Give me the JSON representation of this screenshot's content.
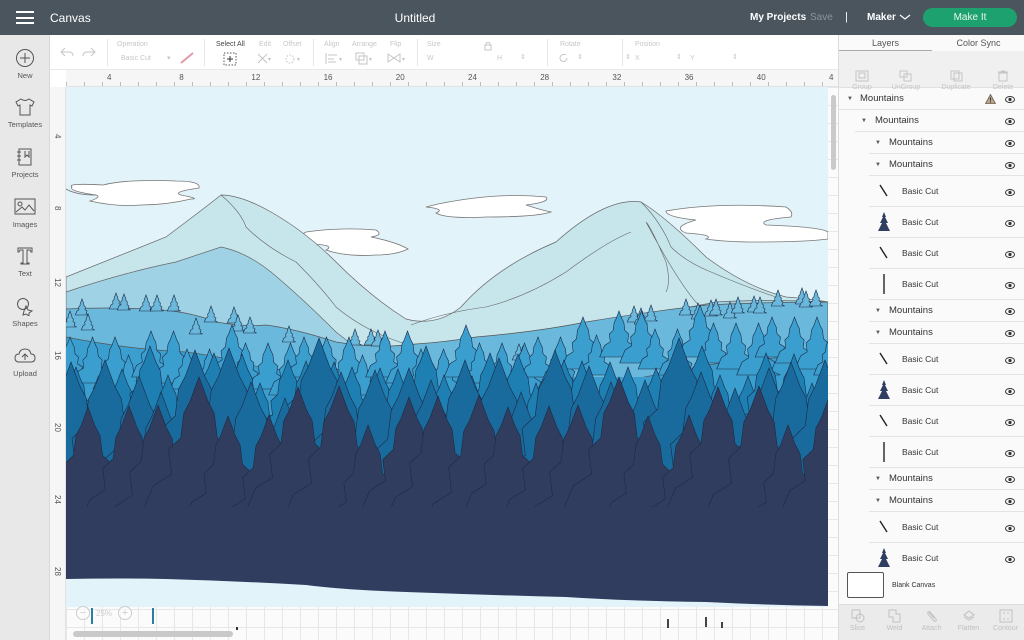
{
  "topbar": {
    "menu_icon": "hamburger-icon",
    "app_name": "Canvas",
    "doc_title": "Untitled",
    "my_projects": "My Projects",
    "save": "Save",
    "separator": "|",
    "machine": "Maker",
    "make_it": "Make It",
    "make_it_color": "#1da16f"
  },
  "leftnav": {
    "items": [
      {
        "label": "New",
        "icon": "plus-circle-icon"
      },
      {
        "label": "Templates",
        "icon": "tshirt-icon"
      },
      {
        "label": "Projects",
        "icon": "notebook-icon"
      },
      {
        "label": "Images",
        "icon": "image-icon"
      },
      {
        "label": "Text",
        "icon": "text-t-icon"
      },
      {
        "label": "Shapes",
        "icon": "shapes-icon"
      },
      {
        "label": "Upload",
        "icon": "cloud-upload-icon"
      }
    ]
  },
  "toolbar": {
    "undo": "undo-icon",
    "redo": "redo-icon",
    "operation_label": "Operation",
    "operation_value": "Basic Cut",
    "select_all": "Select All",
    "edit": "Edit",
    "offset": "Offset",
    "align": "Align",
    "arrange": "Arrange",
    "flip": "Flip",
    "size": "Size",
    "w": "W",
    "h": "H",
    "rotate": "Rotate",
    "position": "Position",
    "x": "X",
    "y": "Y"
  },
  "rulers": {
    "horizontal": [
      "4",
      "8",
      "12",
      "16",
      "20",
      "24",
      "28",
      "32",
      "36",
      "40",
      "4"
    ],
    "vertical": [
      "4",
      "8",
      "12",
      "16",
      "20",
      "24",
      "28"
    ]
  },
  "canvas": {
    "zoom_level": "25%",
    "zoom_out": "−",
    "zoom_in": "+",
    "colors": {
      "sky": "#e3f3fa",
      "cloud": "#ffffff",
      "mountain_far": "#c6e6ec",
      "mountain_mid": "#9fd2e4",
      "hills_1": "#6ab9dc",
      "hills_2": "#3a9fcf",
      "forest_1": "#1e7fb3",
      "forest_2": "#1a6b9d",
      "forest_front": "#313d5e"
    }
  },
  "panel": {
    "tabs": [
      "Layers",
      "Color Sync"
    ],
    "actions": [
      "Group",
      "UnGroup",
      "Duplicate",
      "Delete"
    ],
    "layers": [
      {
        "type": "group",
        "name": "Mountains",
        "level": 0,
        "warning": true
      },
      {
        "type": "group",
        "name": "Mountains",
        "level": 1
      },
      {
        "type": "group",
        "name": "Mountains",
        "level": 2
      },
      {
        "type": "group",
        "name": "Mountains",
        "level": 2
      },
      {
        "type": "cut",
        "name": "Basic Cut",
        "thumb": "slash"
      },
      {
        "type": "cut",
        "name": "Basic Cut",
        "thumb": "tree"
      },
      {
        "type": "cut",
        "name": "Basic Cut",
        "thumb": "slash"
      },
      {
        "type": "cut",
        "name": "Basic Cut",
        "thumb": "line"
      },
      {
        "type": "group",
        "name": "Mountains",
        "level": 2
      },
      {
        "type": "group",
        "name": "Mountains",
        "level": 2
      },
      {
        "type": "cut",
        "name": "Basic Cut",
        "thumb": "slash"
      },
      {
        "type": "cut",
        "name": "Basic Cut",
        "thumb": "tree"
      },
      {
        "type": "cut",
        "name": "Basic Cut",
        "thumb": "slash"
      },
      {
        "type": "cut",
        "name": "Basic Cut",
        "thumb": "line"
      },
      {
        "type": "group",
        "name": "Mountains",
        "level": 2
      },
      {
        "type": "group",
        "name": "Mountains",
        "level": 2
      },
      {
        "type": "cut",
        "name": "Basic Cut",
        "thumb": "slash"
      },
      {
        "type": "cut",
        "name": "Basic Cut",
        "thumb": "tree"
      }
    ],
    "blank_canvas": "Blank Canvas",
    "bottom_actions": [
      "Slice",
      "Weld",
      "Attach",
      "Flatten",
      "Contour"
    ]
  }
}
